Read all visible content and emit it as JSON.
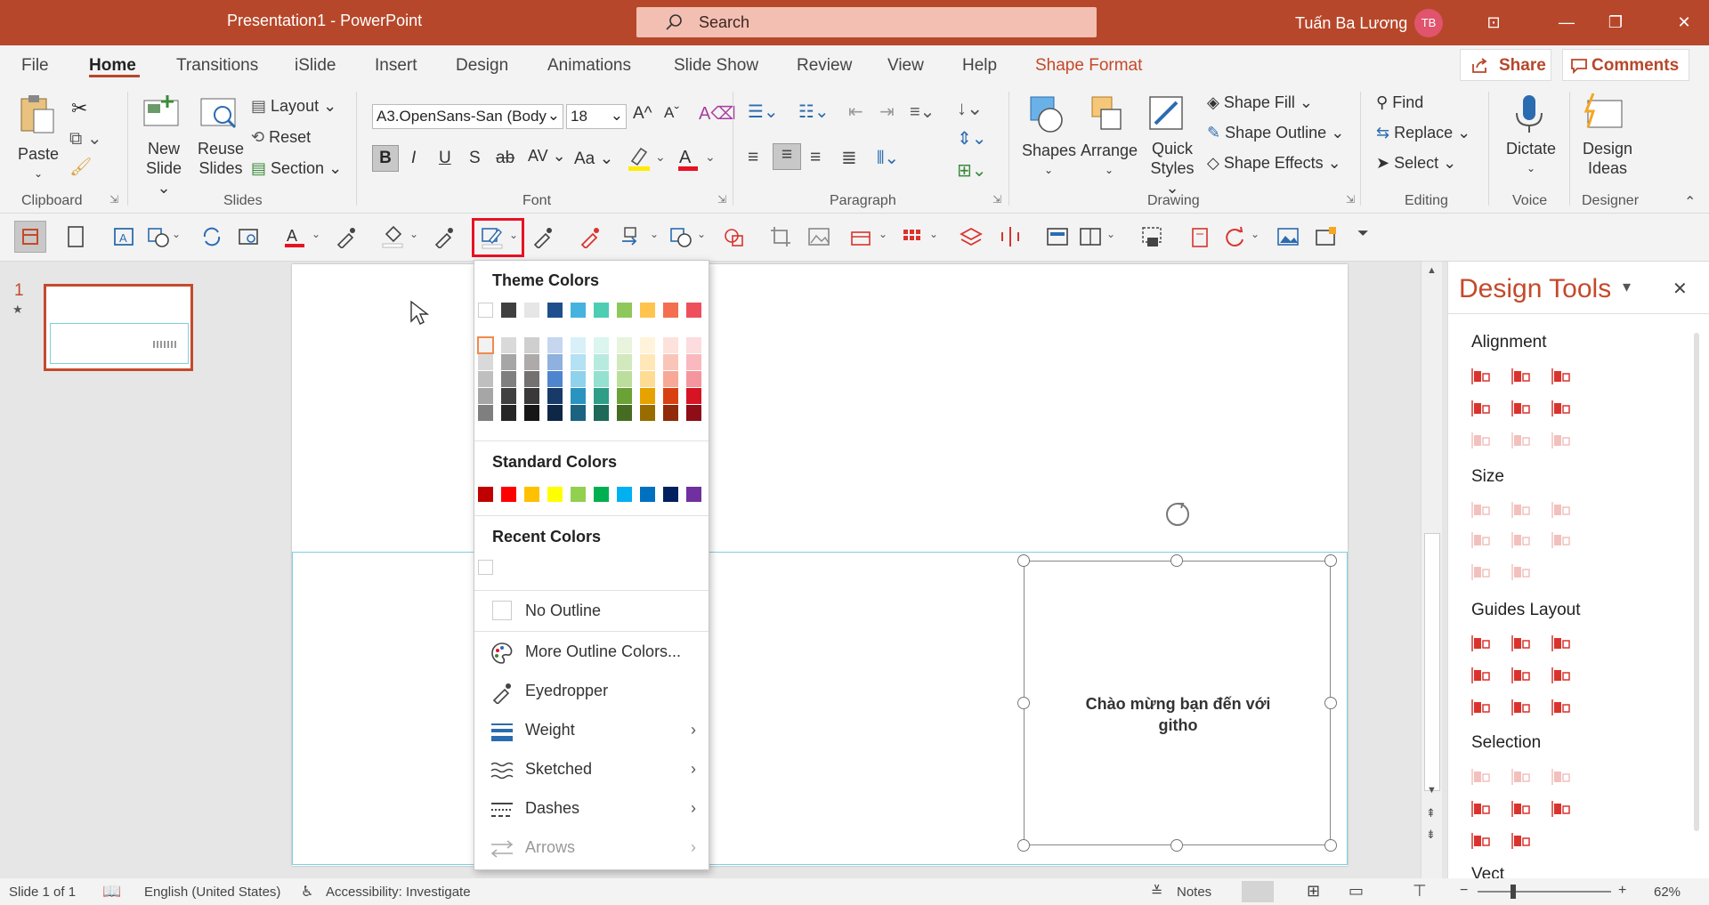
{
  "window": {
    "title": "Presentation1  -  PowerPoint",
    "search_placeholder": "Search",
    "user_name": "Tuấn Ba Lương",
    "user_initials": "TB"
  },
  "tabs": [
    "File",
    "Home",
    "Transitions",
    "iSlide",
    "Insert",
    "Design",
    "Animations",
    "Slide Show",
    "Review",
    "View",
    "Help",
    "Shape Format"
  ],
  "share_label": "Share",
  "comments_label": "Comments",
  "ribbon": {
    "clipboard": {
      "paste": "Paste",
      "group": "Clipboard"
    },
    "slides": {
      "new_slide_1": "New",
      "new_slide_2": "Slide",
      "reuse_1": "Reuse",
      "reuse_2": "Slides",
      "layout": "Layout",
      "reset": "Reset",
      "section": "Section",
      "group": "Slides"
    },
    "font": {
      "font_name": "A3.OpenSans-San (Body",
      "font_size": "18",
      "group": "Font"
    },
    "paragraph": {
      "group": "Paragraph"
    },
    "drawing": {
      "shapes": "Shapes",
      "arrange": "Arrange",
      "quick_1": "Quick",
      "quick_2": "Styles",
      "shape_fill": "Shape Fill",
      "shape_outline": "Shape Outline",
      "shape_effects": "Shape Effects",
      "group": "Drawing"
    },
    "editing": {
      "find": "Find",
      "replace": "Replace",
      "select": "Select",
      "group": "Editing"
    },
    "voice": {
      "dictate": "Dictate",
      "group": "Voice"
    },
    "designer": {
      "design_1": "Design",
      "design_2": "Ideas",
      "group": "Designer"
    }
  },
  "slide_number": "1",
  "slide_text_line1": "Chào mừng bạn đến với",
  "slide_text_line2": "githo",
  "dropdown": {
    "theme_colors_label": "Theme Colors",
    "standard_colors_label": "Standard Colors",
    "recent_colors_label": "Recent Colors",
    "no_outline": "No Outline",
    "more_colors": "More Outline Colors...",
    "eyedropper": "Eyedropper",
    "weight": "Weight",
    "sketched": "Sketched",
    "dashes": "Dashes",
    "arrows": "Arrows",
    "theme_top": [
      "#ffffff",
      "#404040",
      "#e7e6e6",
      "#1f4e8c",
      "#45b3e0",
      "#4dcdb1",
      "#8fc85a",
      "#ffc44d",
      "#f36f50",
      "#ef4f5c"
    ],
    "theme_shades": [
      [
        "#f2f2f2",
        "#d9d9d9",
        "#bfbfbf",
        "#a6a6a6",
        "#7f7f7f"
      ],
      [
        "#d9d9d9",
        "#a6a6a6",
        "#7f7f7f",
        "#404040",
        "#262626"
      ],
      [
        "#cfcfcf",
        "#aeaaaa",
        "#757171",
        "#3a3838",
        "#171616"
      ],
      [
        "#c6d6ef",
        "#8eb1df",
        "#4f85cf",
        "#173a69",
        "#0f2746"
      ],
      [
        "#d9f0f9",
        "#b4e1f3",
        "#8fd2ec",
        "#2a94c1",
        "#1c6381"
      ],
      [
        "#dbf5ef",
        "#b8ebe0",
        "#94e1d0",
        "#2f9e86",
        "#1f6959"
      ],
      [
        "#e8f4de",
        "#d2e9bd",
        "#bcde9c",
        "#6aa236",
        "#466c24"
      ],
      [
        "#fff3db",
        "#ffe7b8",
        "#ffdc94",
        "#e6a300",
        "#996c00"
      ],
      [
        "#fde2dc",
        "#fac5b9",
        "#f8a896",
        "#d9400f",
        "#902a0a"
      ],
      [
        "#fcdcde",
        "#f9b9be",
        "#f5959d",
        "#d61423",
        "#8e0d17"
      ]
    ],
    "standard": [
      "#c00000",
      "#ff0000",
      "#ffc000",
      "#ffff00",
      "#92d050",
      "#00b050",
      "#00b0f0",
      "#0070c0",
      "#002060",
      "#7030a0"
    ],
    "recent": [
      "#ffffff"
    ]
  },
  "design_tools": {
    "title": "Design Tools",
    "alignment": "Alignment",
    "size": "Size",
    "guides_layout": "Guides Layout",
    "selection": "Selection",
    "vector": "Vect"
  },
  "status": {
    "slide_of": "Slide 1 of 1",
    "language": "English (United States)",
    "accessibility": "Accessibility: Investigate",
    "notes": "Notes",
    "zoom": "62%"
  },
  "colors": {
    "accent": "#b7472a",
    "highlight_border": "#e81123"
  }
}
